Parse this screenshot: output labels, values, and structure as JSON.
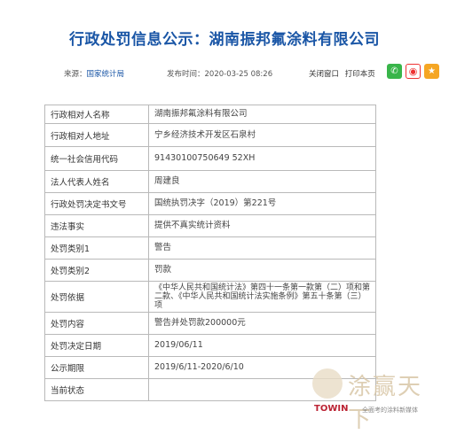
{
  "page": {
    "title": "行政处罚信息公示：湖南振邦氟涂料有限公司"
  },
  "meta": {
    "source_label": "来源：",
    "source_link": "国家统计局",
    "publish_time": "发布时间：2020-03-25 08:26",
    "close_window": "关闭窗口",
    "print_page": "打印本页"
  },
  "share": [
    {
      "name": "wechat",
      "glyph": "✆"
    },
    {
      "name": "weibo",
      "glyph": "◉"
    },
    {
      "name": "favorite",
      "glyph": "★"
    }
  ],
  "rows": [
    {
      "label": "行政相对人名称",
      "value": "湖南振邦氟涂料有限公司"
    },
    {
      "label": "行政相对人地址",
      "value": "宁乡经济技术开发区石泉村"
    },
    {
      "label": "统一社会信用代码",
      "value": "91430100750649 52XH"
    },
    {
      "label": "法人代表人姓名",
      "value": "周建良"
    },
    {
      "label": "行政处罚决定书文号",
      "value": "国统执罚决字（2019）第221号"
    },
    {
      "label": "违法事实",
      "value": "提供不真实统计资料"
    },
    {
      "label": "处罚类别1",
      "value": "警告"
    },
    {
      "label": "处罚类别2",
      "value": "罚款"
    },
    {
      "label": "处罚依据",
      "value": "《中华人民共和国统计法》第四十一条第一款第（二）项和第二款、《中华人民共和国统计法实施条例》第五十条第（三）项"
    },
    {
      "label": "处罚内容",
      "value": "警告并处罚款200000元"
    },
    {
      "label": "处罚决定日期",
      "value": "2019/06/11"
    },
    {
      "label": "公示期限",
      "value": "2019/6/11-2020/6/10"
    },
    {
      "label": "当前状态",
      "value": ""
    }
  ],
  "watermark": {
    "text": "涂赢天下",
    "brand": "TOWIN",
    "brand_sub": "全面考的涂料新媒体"
  }
}
